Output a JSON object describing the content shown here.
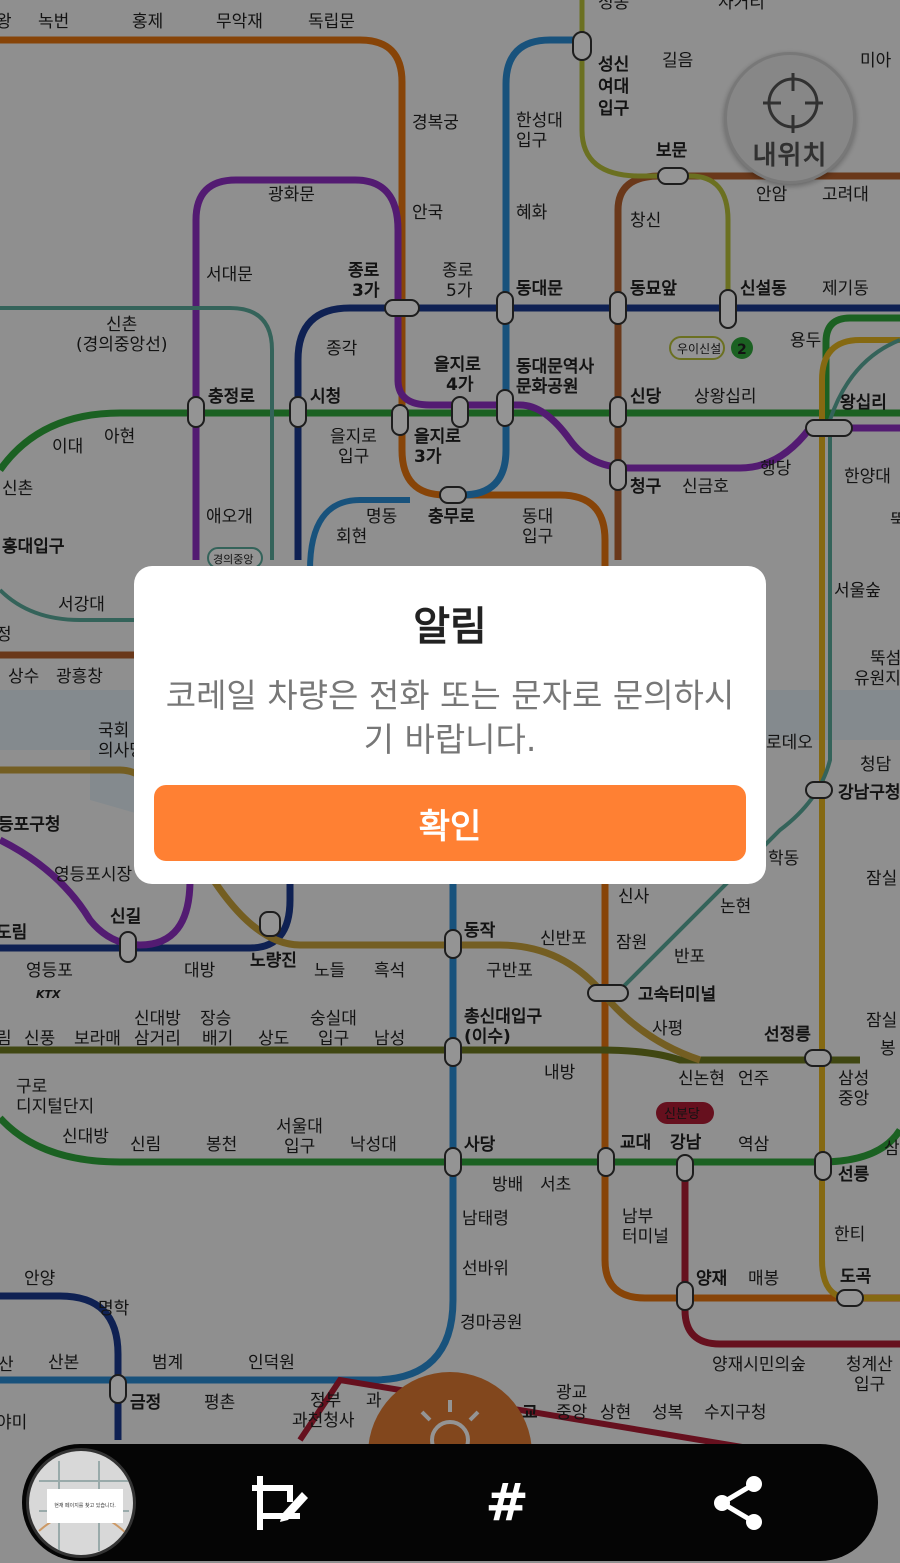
{
  "colors": {
    "line1": "#1a3a8f",
    "line2": "#2fa83c",
    "line3": "#e8760f",
    "line4": "#2a8ed6",
    "line5": "#8f2fc4",
    "line6": "#b7612d",
    "line7": "#6f7a1f",
    "line9": "#c9a23b",
    "sinbundang": "#b01c35",
    "gyeongui": "#5aab9b",
    "ui_sinseol": "#b8c23a",
    "accent": "#ff8033",
    "toolbar": "#050505"
  },
  "map": {
    "stations": {
      "nokbeon": "녹번",
      "hongje": "홍제",
      "muakjae": "무악재",
      "dongnimmun": "독립문",
      "gyeongbokgung": "경복궁",
      "hansungdae": "한성대",
      "hansungdae_2": "입구",
      "seongsin": "성신",
      "seongsin_2": "여대",
      "seongsin_3": "입구",
      "gireum": "길음",
      "mia": "미아",
      "bomun": "보문",
      "anam": "안암",
      "goryeodae": "고려대",
      "gwanghwamun": "광화문",
      "anguk": "안국",
      "hyehwa": "혜화",
      "changsin": "창신",
      "seodaemun": "서대문",
      "jongno3": "종로",
      "jongno3_2": "3가",
      "jongno5": "종로",
      "jongno5_2": "5가",
      "dongdaemun": "동대문",
      "dongmyo": "동묘앞",
      "sinseol": "신설동",
      "jegi": "제기동",
      "sinchon_g": "신촌",
      "sinchon_g_2": "(경의중앙선)",
      "jonggak": "종각",
      "euljiro4": "을지로",
      "euljiro4_2": "4가",
      "ddp": "동대문역사",
      "ddp_2": "문화공원",
      "uisinseol_badge": "우이신설",
      "line2_badge": "2",
      "yongdu": "용두",
      "chungjeongno": "충정로",
      "sicheong": "시청",
      "sindang": "신당",
      "sangwangsimni": "상왕십리",
      "wangsimni": "왕십리",
      "idae": "이대",
      "ahyeon": "아현",
      "euljiro1": "을지로",
      "euljiro1_2": "입구",
      "euljiro3": "을지로",
      "euljiro3_2": "3가",
      "sinchon": "신촌",
      "haengdang": "행당",
      "hanyangdae": "한양대",
      "cheonggu": "청구",
      "singeumho": "신금호",
      "ttuk": "뚝",
      "hongdae": "홍대입구",
      "aeogae": "애오개",
      "myeongdong": "명동",
      "chungmuro": "충무로",
      "dongdae": "동대",
      "dongdae_2": "입구",
      "hoehyeon": "회현",
      "gyeongui_badge": "경의중앙",
      "seogangdae": "서강대",
      "seoulsup": "서울숲",
      "sangsu": "상수",
      "gwangheungchang": "광흥창",
      "ttukseom": "뚝섬",
      "ttukseom_2": "유원지",
      "national_assembly": "국회",
      "national_assembly_2": "의사당",
      "rodeo": "로데오",
      "cheongdam": "청담",
      "gangnamgu": "강남구청",
      "yeongdeungpo_gu": "등포구청",
      "hakdong": "학동",
      "jamsil_top": "잠실",
      "yeongdeungpo_market": "영등포시장",
      "sinsa": "신사",
      "nonhyeon": "논현",
      "dorim": "도림",
      "singil": "신길",
      "dongjak": "동작",
      "sinbanpo": "신반포",
      "jamwon": "잠원",
      "banpo": "반포",
      "yeongdeungpo": "영등포",
      "daebang": "대방",
      "noryangjin": "노량진",
      "nodeul": "노들",
      "heukseok": "흑석",
      "gubanpo": "구반포",
      "express_terminal": "고속터미널",
      "ktx_badge": "KTX",
      "sindaebang3": "신대방",
      "sindaebang3_2": "삼거리",
      "jangseung": "장승",
      "jangseung_2": "배기",
      "soongsil": "숭실대",
      "soongsil_2": "입구",
      "chongsin": "총신대입구",
      "chongsin_2": "(이수)",
      "sapyeong": "사평",
      "seonjeongneung": "선정릉",
      "jamsil2": "잠실",
      "rim": "림",
      "sinpung": "신풍",
      "boramae": "보라매",
      "sangdo": "상도",
      "namseong": "남성",
      "naebang": "내방",
      "sinnonhyeon": "신논현",
      "eonju": "언주",
      "samseongjungang": "삼성",
      "samseongjungang_2": "중앙",
      "bong": "봉",
      "guro_digital": "구로",
      "guro_digital_2": "디지털단지",
      "sinbundang_badge": "신분당",
      "sindaebang": "신대방",
      "sillim": "신림",
      "bongcheon": "봉천",
      "seouldae": "서울대",
      "seouldae_2": "입구",
      "nakseongdae": "낙성대",
      "sadang": "사당",
      "gyodae": "교대",
      "gangnam": "강남",
      "yeoksam": "역삼",
      "seolleung": "선릉",
      "sam": "삼",
      "bangbae": "방배",
      "seocho": "서초",
      "namtaeryeong": "남태령",
      "nambu": "남부",
      "nambu_2": "터미널",
      "hanti": "한티",
      "anyang": "안양",
      "seonbawi": "선바위",
      "myeonghak": "명학",
      "yangjae": "양재",
      "maebong": "매봉",
      "dogok": "도곡",
      "gyeongma": "경마공원",
      "san": "산",
      "sanbon": "산본",
      "beomgye": "범계",
      "indeogwon": "인덕원",
      "yangjae_forest": "양재시민의숲",
      "cheonggyesan": "청계산",
      "cheonggyesan_2": "입구",
      "geumjeong": "금정",
      "pyeongchon": "평촌",
      "gwacheon": "정부",
      "gwacheon_2": "과천청사",
      "gwa": "과",
      "gyo": "교",
      "gwanggyo": "광교",
      "gwanggyo_2": "중앙",
      "sanghyeon": "상현",
      "seongbok": "성복",
      "suji": "수지구청",
      "yami": "야미",
      "top_1": "성동",
      "top_2": "사거리",
      "top_wang": "왕",
      "jeong": "정"
    }
  },
  "location_button": {
    "label": "내위치"
  },
  "dialog": {
    "title": "알림",
    "message": "코레일 차량은 전화 또는 문자로 문의하시기 바랍니다.",
    "confirm_label": "확인"
  },
  "toolbar": {
    "thumbnail_caption": "현재 페이지를 찾고 있습니다.",
    "hash_label": "#",
    "icons": [
      "thumbnail",
      "crop-edit-icon",
      "hash-icon",
      "share-icon"
    ]
  }
}
